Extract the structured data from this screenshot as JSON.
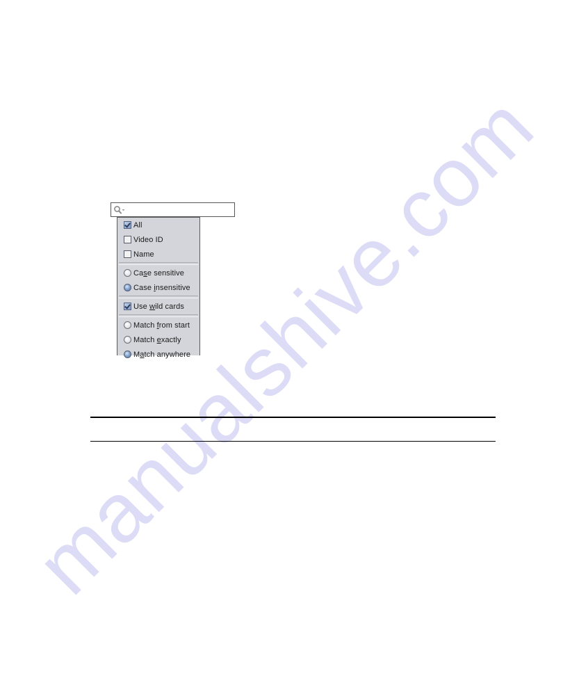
{
  "watermark": {
    "text": "manualshive.com",
    "color": "#d9d9f7"
  },
  "search": {
    "value": "",
    "icon": "search-icon-with-dropdown"
  },
  "menu": {
    "groups": [
      {
        "type": "checkbox",
        "items": [
          {
            "label": "All",
            "checked": true,
            "mnemonic": ""
          },
          {
            "label": "Video ID",
            "checked": false,
            "mnemonic": ""
          },
          {
            "label": "Name",
            "checked": false,
            "mnemonic": ""
          }
        ]
      },
      {
        "type": "radio",
        "items": [
          {
            "label": "Case sensitive",
            "checked": false,
            "mnemonic": "s"
          },
          {
            "label": "Case insensitive",
            "checked": true,
            "mnemonic": "i"
          }
        ]
      },
      {
        "type": "checkbox",
        "items": [
          {
            "label": "Use wild cards",
            "checked": true,
            "mnemonic": "w"
          }
        ]
      },
      {
        "type": "radio",
        "items": [
          {
            "label": "Match from start",
            "checked": false,
            "mnemonic": "f"
          },
          {
            "label": "Match exactly",
            "checked": false,
            "mnemonic": "e"
          },
          {
            "label": "Match anywhere",
            "checked": true,
            "mnemonic": "a"
          }
        ]
      }
    ]
  },
  "colors": {
    "menu_background": "#d4d5db",
    "menu_border": "#5a5a5a",
    "checked_accent": "#7f9cc8",
    "rule": "#000000"
  }
}
